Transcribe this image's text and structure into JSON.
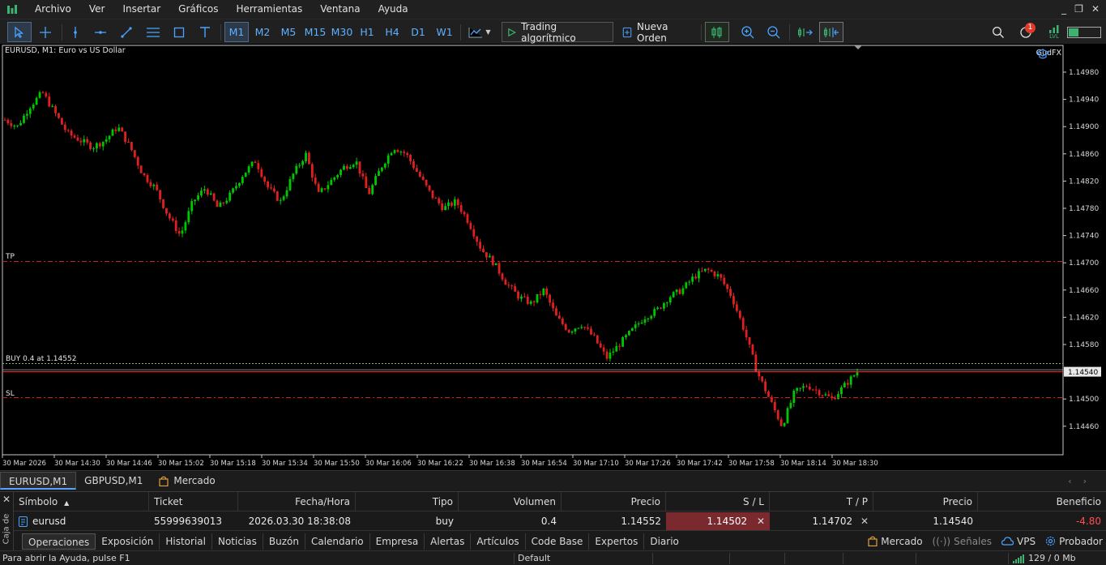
{
  "menubar": {
    "items": [
      "Archivo",
      "Ver",
      "Insertar",
      "Gráficos",
      "Herramientas",
      "Ventana",
      "Ayuda"
    ]
  },
  "toolbar": {
    "timeframes": [
      "M1",
      "M2",
      "M5",
      "M15",
      "M30",
      "H1",
      "H4",
      "D1",
      "W1"
    ],
    "active_timeframe": "M1",
    "algo_trading_label": "Trading algorítmico",
    "new_order_label": "Nueva Orden",
    "notification_count": "1",
    "signal_label": "LVL"
  },
  "chart": {
    "title": "EURUSD, M1:  Euro vs US Dollar",
    "broker_label": "GudFX",
    "tp_label": "TP",
    "sl_label": "SL",
    "buy_label": "BUY 0.4 at 1.14552",
    "current_price": "1.14540",
    "price_ticks": [
      "1.14980",
      "1.14940",
      "1.14900",
      "1.14860",
      "1.14820",
      "1.14780",
      "1.14740",
      "1.14700",
      "1.14660",
      "1.14620",
      "1.14580",
      "1.14500",
      "1.14460"
    ],
    "time_ticks": [
      "30 Mar 2026",
      "30 Mar 14:30",
      "30 Mar 14:46",
      "30 Mar 15:02",
      "30 Mar 15:18",
      "30 Mar 15:34",
      "30 Mar 15:50",
      "30 Mar 16:06",
      "30 Mar 16:22",
      "30 Mar 16:38",
      "30 Mar 16:54",
      "30 Mar 17:10",
      "30 Mar 17:26",
      "30 Mar 17:42",
      "30 Mar 17:58",
      "30 Mar 18:14",
      "30 Mar 18:30"
    ],
    "colors": {
      "bull": "#00c800",
      "bear": "#e02020",
      "tp_sl_line": "#d02020",
      "buy_line": "#7ab87a",
      "price_line": "#ff3030"
    }
  },
  "chart_data": {
    "type": "candlestick",
    "symbol": "EURUSD",
    "timeframe": "M1",
    "ylim": [
      1.1444,
      1.15
    ],
    "levels": {
      "tp": 1.14702,
      "sl": 1.14502,
      "buy": 1.14552,
      "bid": 1.1454
    },
    "close_path": [
      1.1491,
      1.149,
      1.1493,
      1.1495,
      1.1492,
      1.1489,
      1.1488,
      1.1487,
      1.1488,
      1.149,
      1.1487,
      1.1483,
      1.1481,
      1.1477,
      1.1474,
      1.1479,
      1.1481,
      1.1478,
      1.148,
      1.1483,
      1.1485,
      1.1481,
      1.1479,
      1.1483,
      1.1486,
      1.148,
      1.1482,
      1.1484,
      1.1485,
      1.148,
      1.1484,
      1.1487,
      1.1486,
      1.1483,
      1.148,
      1.1478,
      1.1479,
      1.1476,
      1.1472,
      1.147,
      1.1467,
      1.1465,
      1.1464,
      1.1466,
      1.1462,
      1.146,
      1.1461,
      1.1459,
      1.1456,
      1.1458,
      1.146,
      1.1462,
      1.1463,
      1.1465,
      1.1466,
      1.1468,
      1.1469,
      1.1468,
      1.1465,
      1.146,
      1.1454,
      1.145,
      1.1446,
      1.1451,
      1.1452,
      1.1451,
      1.145,
      1.1452,
      1.1454
    ]
  },
  "chart_tabs": [
    "EURUSD,M1",
    "GBPUSD,M1",
    "Mercado"
  ],
  "toolbox": {
    "side_label": "Caja de",
    "columns": [
      "Símbolo",
      "Ticket",
      "Fecha/Hora",
      "Tipo",
      "Volumen",
      "Precio",
      "S / L",
      "T / P",
      "Precio",
      "Beneficio"
    ],
    "rows": [
      {
        "symbol": "eurusd",
        "ticket": "55999639013",
        "time": "2026.03.30 18:38:08",
        "type": "buy",
        "volume": "0.4",
        "open_price": "1.14552",
        "sl": "1.14502",
        "tp": "1.14702",
        "price": "1.14540",
        "profit": "-4.80"
      }
    ],
    "tabs": [
      "Operaciones",
      "Exposición",
      "Historial",
      "Noticias",
      "Buzón",
      "Calendario",
      "Empresa",
      "Alertas",
      "Artículos",
      "Code Base",
      "Expertos",
      "Diario"
    ],
    "right_tabs": [
      "Mercado",
      "Señales",
      "VPS",
      "Probador"
    ]
  },
  "statusbar": {
    "help": "Para abrir la Ayuda, pulse F1",
    "profile": "Default",
    "connection": "129 / 0 Mb"
  }
}
